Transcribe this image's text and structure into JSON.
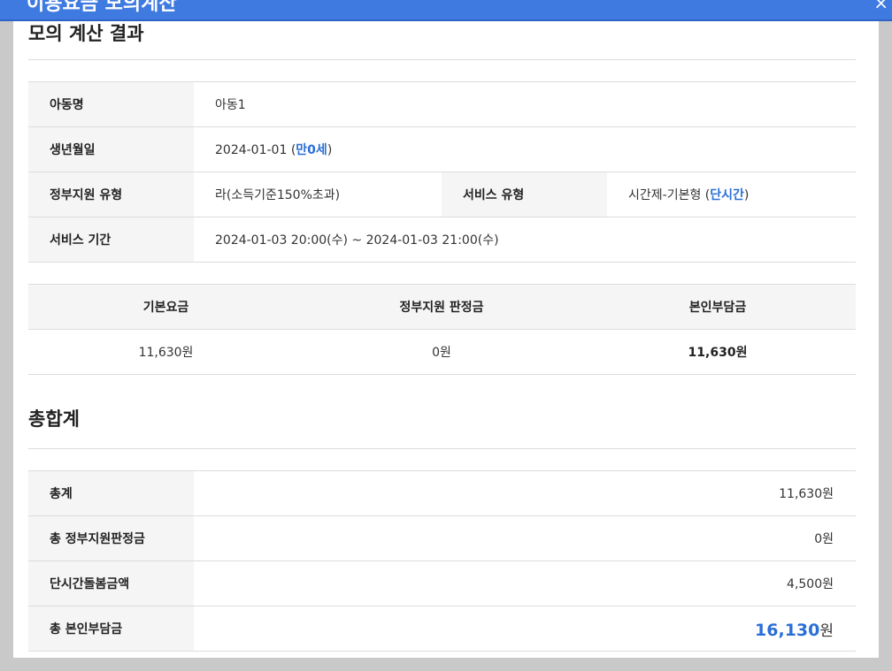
{
  "modal": {
    "title": "이용요금 모의계산",
    "close_icon": "×"
  },
  "calc_section": {
    "title": "모의 계산 결과",
    "child_name_label": "아동명",
    "child_name": "아동1",
    "birth_label": "생년월일",
    "birth_date": "2024-01-01",
    "birth_age": "만0세",
    "support_type_label": "정부지원 유형",
    "support_type": "라(소득기준150%초과)",
    "service_type_label": "서비스 유형",
    "service_type": "시간제-기본형",
    "service_type_tag": "단시간",
    "period_label": "서비스 기간",
    "period": "2024-01-03 20:00(수) ~ 2024-01-03 21:00(수)"
  },
  "fee_table": {
    "headers": [
      "기본요금",
      "정부지원 판정금",
      "본인부담금"
    ],
    "values": [
      "11,630원",
      "0원",
      "11,630원"
    ]
  },
  "total_section": {
    "title": "총합계",
    "rows": [
      {
        "label": "총계",
        "value": "11,630원"
      },
      {
        "label": "총 정부지원판정금",
        "value": "0원"
      },
      {
        "label": "단시간돌봄금액",
        "value": "4,500원"
      }
    ],
    "final_label": "총 본인부담금",
    "final_amount": "16,130",
    "final_unit": "원"
  }
}
